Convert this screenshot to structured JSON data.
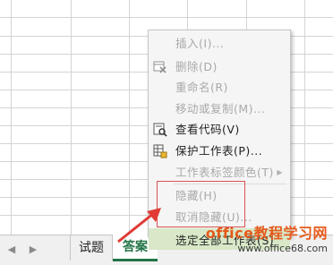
{
  "sheet_tabs": [
    "试题",
    "答案"
  ],
  "nav": {
    "prev_icon": "◀",
    "next_icon": "▶"
  },
  "context_menu": {
    "insert": "插入(I)...",
    "delete": "删除(D)",
    "rename": "重命名(R)",
    "move_copy": "移动或复制(M)...",
    "view_code": "查看代码(V)",
    "protect_sheet": "保护工作表(P)...",
    "tab_color": "工作表标签颜色(T)",
    "hide": "隐藏(H)",
    "unhide": "取消隐藏(U)...",
    "select_all": "选定全部工作表(S)"
  },
  "watermark": {
    "line1": "office教程学习网",
    "line2": "www.office68.com"
  },
  "colors": {
    "accent": "#217346",
    "highlight": "#d9534f",
    "watermark": "#e55a1c"
  }
}
